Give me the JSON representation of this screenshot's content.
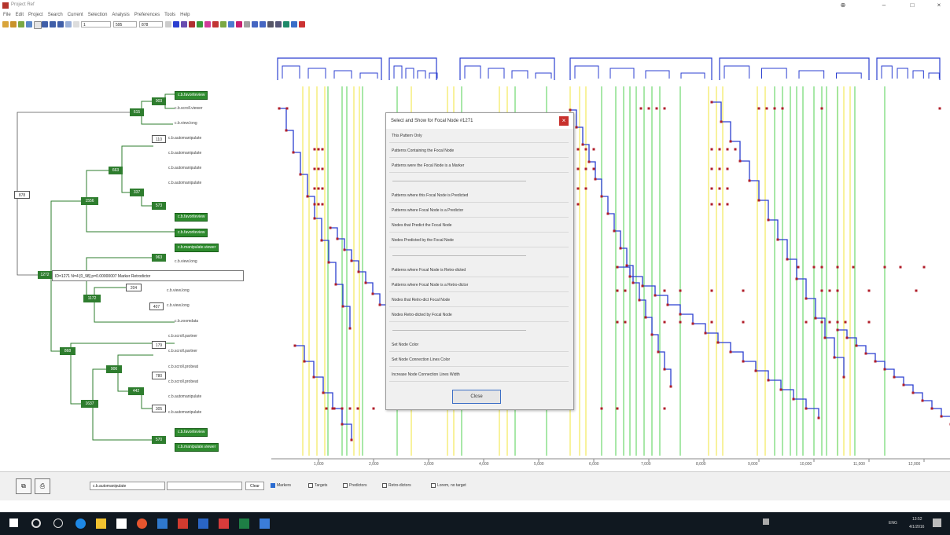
{
  "window": {
    "title": "Project Ref"
  },
  "menu": [
    "File",
    "Edit",
    "Project",
    "Search",
    "Current",
    "Selection",
    "Analysis",
    "Preferences",
    "Tools",
    "Help"
  ],
  "toolbar": {
    "field1": "1",
    "field2": "595",
    "field3": "878"
  },
  "tree": {
    "root": "878",
    "top_nodes": [
      "615",
      "903",
      "1556",
      "663",
      "337",
      "573",
      "963",
      "1272",
      "1172",
      "204",
      "407",
      "868",
      "179",
      "906",
      "780",
      "442",
      "1637",
      "305",
      "570",
      "110"
    ],
    "leaves": [
      "c.b.favoriteview",
      "c.b.scroll.viewer",
      "c.b.view.long",
      "c.b.automanipulate",
      "c.b.automanipulate",
      "c.b.automanipulate",
      "c.b.automanipulate",
      "c.b.favoriteview",
      "c.b.favoriteview",
      "c.b.manipulate.viewer",
      "c.b.view.long",
      "c.b.view.long",
      "c.b.view.long",
      "c.b.zoomdata",
      "c.b.scroll.partner",
      "c.b.scroll.partner",
      "c.b.scroll.probeat",
      "c.b.scroll.probeat",
      "c.b.automanipulate",
      "c.b.automanipulate",
      "c.b.favoriteview",
      "c.b.manipulate.viewer"
    ],
    "tooltip": "ID=1271  N=4  [0_98]  p=0.00000007  Marker  Retrodictor"
  },
  "plot": {
    "x_ticks": [
      "1,000",
      "2,000",
      "3,000",
      "4,000",
      "5,000",
      "6,000",
      "7,000",
      "8,000",
      "9,000",
      "10,000",
      "11,000",
      "12,000"
    ]
  },
  "popup": {
    "title": "Select and Show for Focal Node #1271",
    "items": [
      "This Pattern Only",
      "Patterns Containing the Focal Node",
      "Patterns were the Focal Node is a Marker",
      "Patterns where this Focal Node is Predicted",
      "Patterns where Focal Node is a Predictor",
      "Nodes that Predict the Focal Node",
      "Nodes Predicted by the Focal Node",
      "Patterns where Focal Node is Retro-dicted",
      "Patterns where Focal Node is a Retro-dictor",
      "Nodes that Retro-dict Focal Node",
      "Nodes Retro-dicted by Focal Node",
      "Set Node Color",
      "Set Node Connection Lines Color",
      "Increase Node Connection Lines Width"
    ],
    "close_label": "Close"
  },
  "bottom": {
    "select_value": "c.b.automanipulate",
    "clear_label": "Clear",
    "checks": [
      {
        "label": "Markers",
        "checked": true
      },
      {
        "label": "Targets",
        "checked": false
      },
      {
        "label": "Predictors",
        "checked": false
      },
      {
        "label": "Retro-dictors",
        "checked": false
      },
      {
        "label": "Lorem, no target",
        "checked": false
      }
    ]
  },
  "taskbar": {
    "time": "13:52",
    "date": "4/1/2016",
    "lang": "ENG"
  },
  "colors": {
    "tree_green": "#2e7d2e",
    "plot_blue": "#2b3fd0",
    "marker_red": "#b01e2a",
    "grid_green": "#6ed86e",
    "grid_yellow": "#f2ea5b"
  }
}
